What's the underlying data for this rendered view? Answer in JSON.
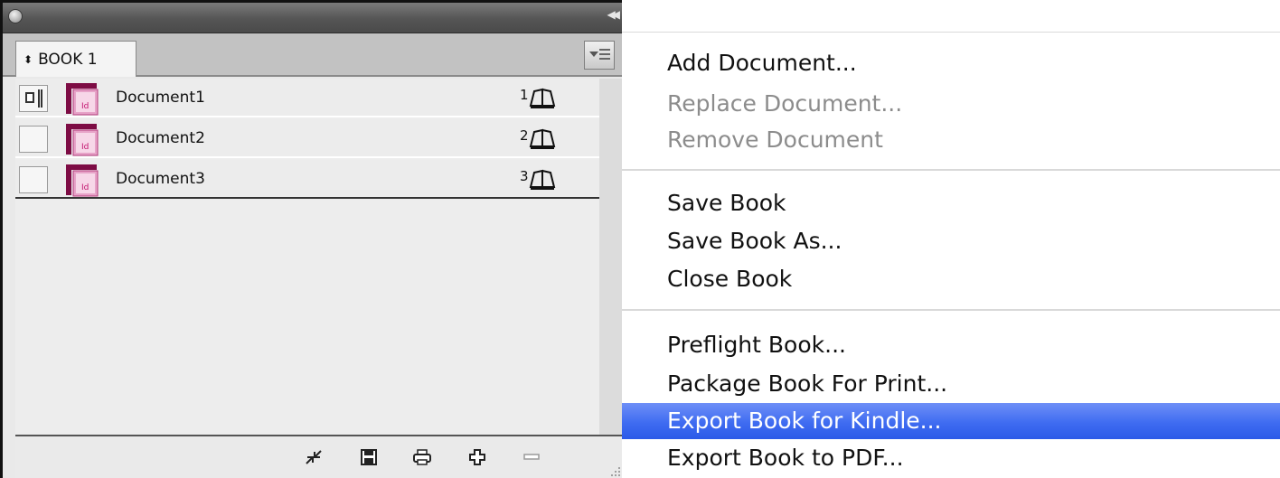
{
  "panel": {
    "tab_label": "BOOK 1",
    "tab_arrows": "♢",
    "documents": [
      {
        "name": "Document1",
        "page": "1",
        "synced": true
      },
      {
        "name": "Document2",
        "page": "2",
        "synced": false
      },
      {
        "name": "Document3",
        "page": "3",
        "synced": false
      }
    ],
    "toolbar": [
      "sync-styles-icon",
      "save-book-icon",
      "print-book-icon",
      "add-document-icon",
      "remove-document-icon"
    ]
  },
  "menu": {
    "items": [
      {
        "label": "Add Document...",
        "enabled": true
      },
      {
        "label": "Replace Document...",
        "enabled": false
      },
      {
        "label": "Remove Document",
        "enabled": false
      },
      {
        "label": "Save Book",
        "enabled": true
      },
      {
        "label": "Save Book As...",
        "enabled": true
      },
      {
        "label": "Close Book",
        "enabled": true
      },
      {
        "label": "Preflight Book...",
        "enabled": true
      },
      {
        "label": "Package Book For Print...",
        "enabled": true
      },
      {
        "label": "Export Book for Kindle...",
        "enabled": true,
        "selected": true
      },
      {
        "label": "Export Book to PDF...",
        "enabled": true
      }
    ]
  },
  "colors": {
    "selection": "#3f6cf1",
    "indesign_pink": "#d6187f"
  }
}
